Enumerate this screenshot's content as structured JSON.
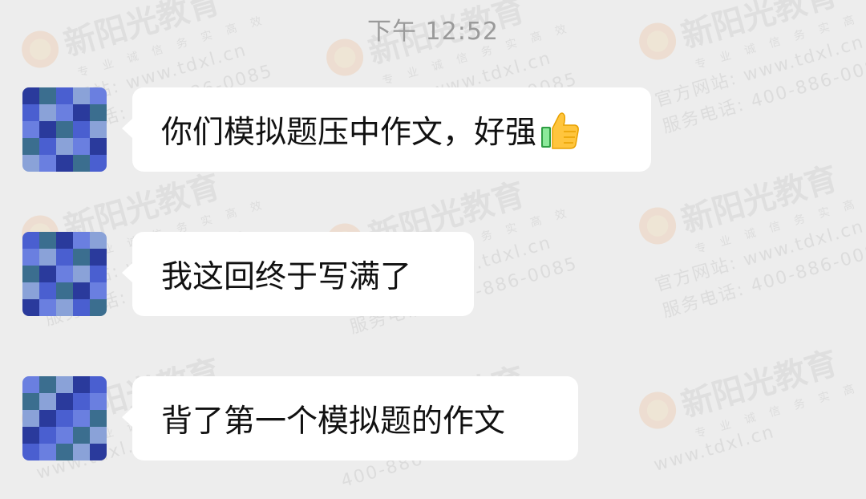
{
  "status": {
    "time": "下午 12:52"
  },
  "watermark": {
    "brand": "新阳光教育",
    "tags": [
      "专业",
      "诚信",
      "务实",
      "高效"
    ],
    "site": "官方网站: www.tdxl.cn",
    "site_short": "www.tdxl.cn",
    "phone": "服务电话: 400-886-0085",
    "phone_short": "400-886-0085"
  },
  "messages": [
    {
      "text": "你们模拟题压中作文，好强",
      "emoji": "thumbs-up-icon"
    },
    {
      "text": "我这回终于写满了"
    },
    {
      "text": "背了第一个模拟题的作文"
    }
  ],
  "colors": {
    "background": "#ededed",
    "bubble": "#ffffff",
    "text": "#111111",
    "timestamp": "#9a9a9a",
    "avatar_blues": [
      "#2a3a9c",
      "#4a5fd0",
      "#6a7fe0",
      "#3b6e8f",
      "#8aa2d8"
    ]
  }
}
